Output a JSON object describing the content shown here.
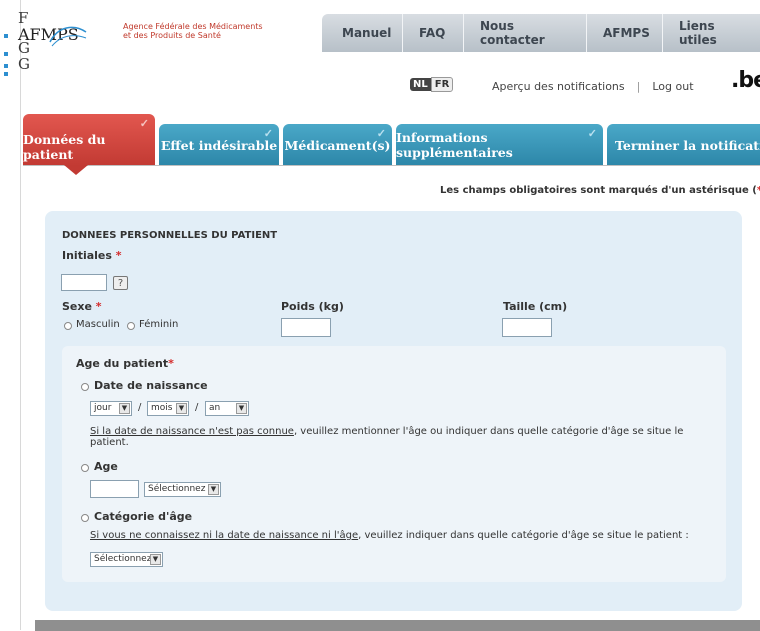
{
  "header": {
    "logo_letters": [
      "F",
      "G",
      "G"
    ],
    "logo_text": "AFMPS",
    "agency_line1": "Agence Fédérale des Médicaments",
    "agency_line2": "et des Produits de Santé",
    "nav": [
      "Manuel",
      "FAQ",
      "Nous contacter",
      "AFMPS",
      "Liens utiles"
    ],
    "lang_nl": "NL",
    "lang_fr": "FR",
    "notif_link": "Aperçu des notifications",
    "separator": "|",
    "logout": "Log out",
    "be_logo": ".be"
  },
  "tabs": [
    {
      "label": "Données du patient",
      "active": true
    },
    {
      "label": "Effet indésirable",
      "active": false
    },
    {
      "label": "Médicament(s)",
      "active": false
    },
    {
      "label": "Informations supplémentaires",
      "active": false
    },
    {
      "label": "Terminer la notification",
      "active": false
    }
  ],
  "required_note": {
    "text": "Les champs obligatoires sont marqués d'un astérisque (",
    "asterisk": "*",
    "end": ")."
  },
  "form": {
    "section_title": "DONNEES PERSONNELLES DU PATIENT",
    "initials_label": "Initiales",
    "asterisk": "*",
    "help_icon": "?",
    "sex_label": "Sexe",
    "sex_options": [
      "Masculin",
      "Féminin"
    ],
    "weight_label": "Poids (kg)",
    "height_label": "Taille (cm)",
    "age_section_label": "Age du patient",
    "dob_label": "Date de naissance",
    "dob_day": "jour",
    "dob_month": "mois",
    "dob_year": "an",
    "slash": "/",
    "dob_note_link": "Si la date de naissance n'est pas connue",
    "dob_note_rest": ", veuillez mentionner l'âge ou indiquer dans quelle catégorie d'âge se situe le",
    "dob_note_line2": "patient.",
    "age_label": "Age",
    "age_select": "Sélectionnez",
    "category_label": "Catégorie d'âge",
    "category_note_link": "Si vous ne connaissez ni la date de naissance ni l'âge",
    "category_note_rest": ", veuillez indiquer dans quelle catégorie d'âge se situe le patient :",
    "category_select": "Sélectionnez"
  },
  "colors": {
    "active_tab": "#c23a33",
    "tab": "#2c86a8",
    "panel": "#e2eef7",
    "required": "#d42b2b"
  }
}
